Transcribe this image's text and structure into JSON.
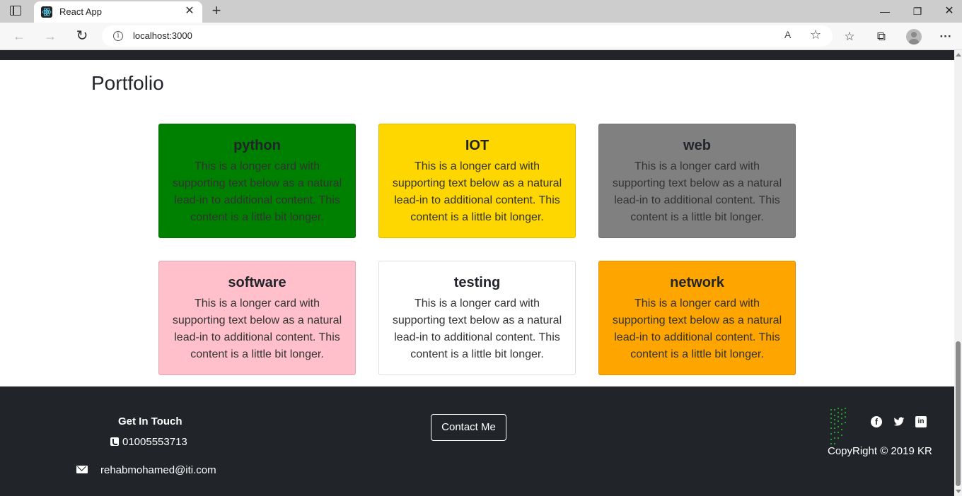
{
  "browser": {
    "tab_title": "React App",
    "tab_close": "✕",
    "new_tab": "+",
    "url": "localhost:3000",
    "read_aloud": "A",
    "window_controls": {
      "minimize": "—",
      "maximize": "❐",
      "close": "✕"
    }
  },
  "page": {
    "section_title": "Portfolio",
    "cards": [
      {
        "title": "python",
        "text": "This is a longer card with supporting text below as a natural lead-in to additional content. This content is a little bit longer.",
        "color": "#008000"
      },
      {
        "title": "IOT",
        "text": "This is a longer card with supporting text below as a natural lead-in to additional content. This content is a little bit longer.",
        "color": "#ffd700"
      },
      {
        "title": "web",
        "text": "This is a longer card with supporting text below as a natural lead-in to additional content. This content is a little bit longer.",
        "color": "#808080"
      },
      {
        "title": "software",
        "text": "This is a longer card with supporting text below as a natural lead-in to additional content. This content is a little bit longer.",
        "color": "#ffc0cb"
      },
      {
        "title": "testing",
        "text": "This is a longer card with supporting text below as a natural lead-in to additional content. This content is a little bit longer.",
        "color": "#ffffff"
      },
      {
        "title": "network",
        "text": "This is a longer card with supporting text below as a natural lead-in to additional content. This content is a little bit longer.",
        "color": "#ffa500"
      }
    ]
  },
  "footer": {
    "heading": "Get In Touch",
    "phone": "01005553713",
    "email": "rehabmohamed@iti.com",
    "contact_button": "Contact Me",
    "copyright": "CopyRight © 2019 KR",
    "social_icons": [
      "facebook-icon",
      "twitter-icon",
      "linkedin-icon"
    ],
    "background": "#212529"
  }
}
